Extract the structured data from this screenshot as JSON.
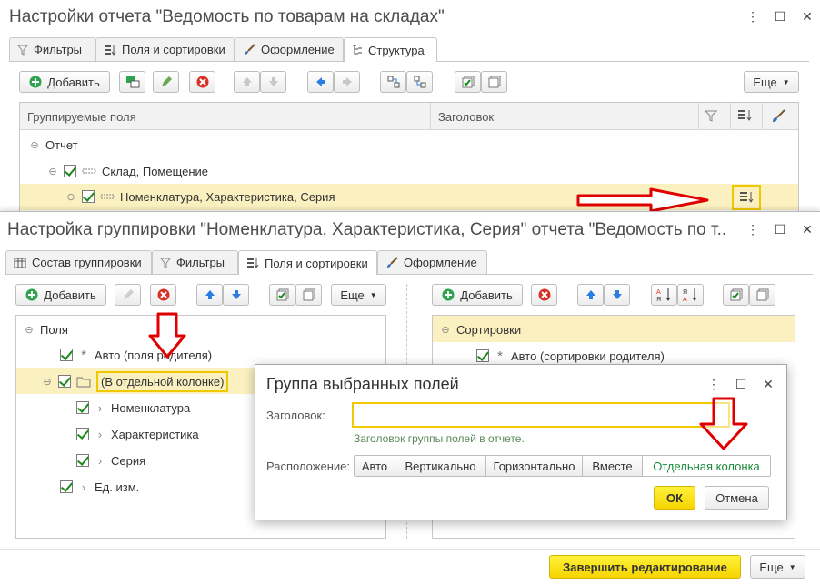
{
  "report_window": {
    "title": "Настройки отчета \"Ведомость по товарам на складах\"",
    "tabs": [
      "Фильтры",
      "Поля и сортировки",
      "Оформление",
      "Структура"
    ],
    "toolbar": {
      "add": "Добавить",
      "more": "Еще"
    },
    "columns": {
      "grouped_fields": "Группируемые поля",
      "header": "Заголовок"
    },
    "tree": {
      "root": "Отчет",
      "level1": "Склад, Помещение",
      "level2": "Номенклатура, Характеристика, Серия"
    }
  },
  "grouping_window": {
    "title": "Настройка группировки \"Номенклатура, Характеристика, Серия\" отчета \"Ведомость по т...",
    "tabs": [
      "Состав группировки",
      "Фильтры",
      "Поля и сортировки",
      "Оформление"
    ],
    "left": {
      "add": "Добавить",
      "more": "Еще",
      "root": "Поля",
      "items": [
        "Авто (поля родителя)",
        "(В отдельной колонке)",
        "Номенклатура",
        "Характеристика",
        "Серия",
        "Ед. изм."
      ]
    },
    "right": {
      "add": "Добавить",
      "root": "Сортировки",
      "item": "Авто (сортировки родителя)"
    },
    "footer": {
      "finish": "Завершить редактирование",
      "more": "Еще"
    }
  },
  "dialog": {
    "title": "Группа выбранных полей",
    "header_label": "Заголовок:",
    "header_value": "",
    "header_hint": "Заголовок группы полей в отчете.",
    "placement_label": "Расположение:",
    "placement_options": [
      "Авто",
      "Вертикально",
      "Горизонтально",
      "Вместе",
      "Отдельная колонка"
    ],
    "placement_selected": "Отдельная колонка",
    "ok": "ОК",
    "cancel": "Отмена"
  },
  "colors": {
    "accent_yellow": "#f6d400",
    "selection": "#fbf0c0",
    "annotation": "#e00000",
    "selected_option": "#1a8a3a"
  }
}
